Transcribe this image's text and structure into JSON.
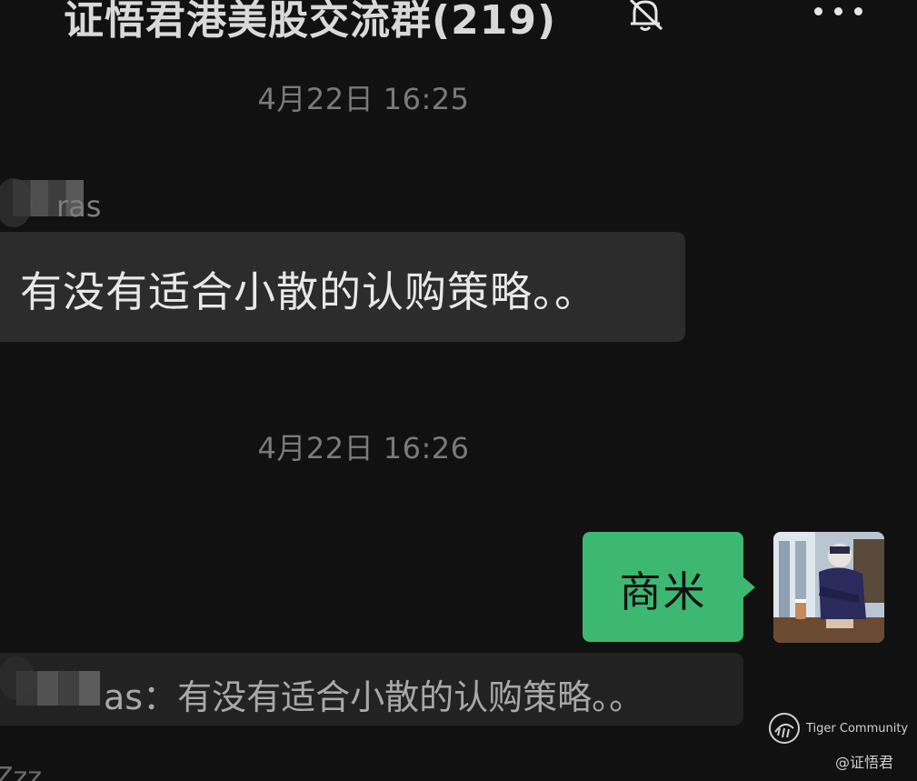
{
  "header": {
    "title": "证悟君港美股交流群(219)",
    "mute_icon": "bell-slash-icon",
    "more_icon": "more-dots-icon"
  },
  "messages": {
    "time1": "4月22日 16:25",
    "sender_name_visible": "ras",
    "msg1_text": "有没有适合小散的认购策略。。",
    "time2": "4月22日 16:26",
    "my_reply_text": "商米",
    "quote_text": "as：有没有适合小散的认购策略。。",
    "bottom_partial": "Zzz"
  },
  "watermark": {
    "brand": "Tiger Community",
    "handle": "@证悟君"
  },
  "colors": {
    "background": "#111111",
    "bubble_other": "#2c2c2c",
    "bubble_self": "#3cb872",
    "quote_bg": "#222222"
  }
}
